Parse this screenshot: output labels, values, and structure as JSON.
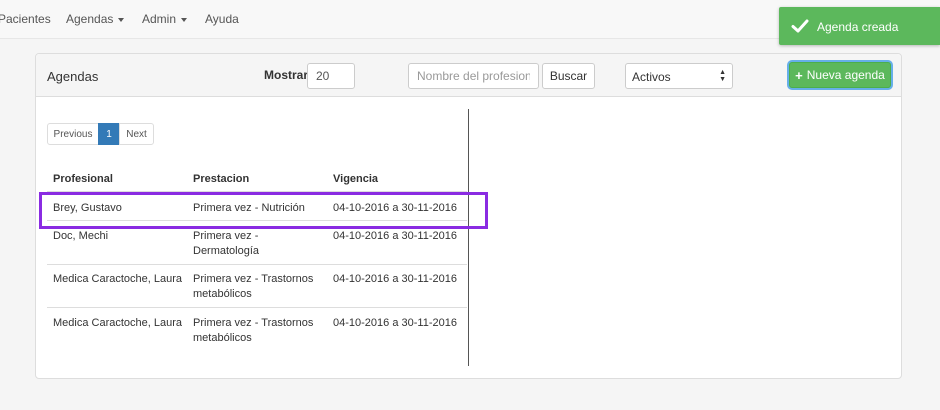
{
  "nav": {
    "items": [
      {
        "label": "Pacientes",
        "dropdown": false
      },
      {
        "label": "Agendas",
        "dropdown": true
      },
      {
        "label": "Admin",
        "dropdown": true
      },
      {
        "label": "Ayuda",
        "dropdown": false
      }
    ]
  },
  "toast": {
    "message": "Agenda creada",
    "icon": "check-icon",
    "color": "#5cb85c"
  },
  "panel": {
    "title": "Agendas",
    "mostrar_label": "Mostrar",
    "mostrar_value": "20",
    "search_placeholder": "Nombre del profesional",
    "search_button": "Buscar",
    "status_select": "Activos",
    "new_button": "Nueva agenda"
  },
  "pagination": {
    "previous": "Previous",
    "current": "1",
    "next": "Next"
  },
  "table": {
    "headers": [
      "Profesional",
      "Prestacion",
      "Vigencia"
    ],
    "rows": [
      {
        "profesional": "Brey, Gustavo",
        "prestacion": "Primera vez - Nutrición",
        "vigencia": "04-10-2016 a 30-11-2016"
      },
      {
        "profesional": "Doc, Mechi",
        "prestacion": "Primera vez - Dermatología",
        "vigencia": "04-10-2016 a 30-11-2016"
      },
      {
        "profesional": "Medica Caractoche, Laura",
        "prestacion": "Primera vez - Trastornos metabólicos",
        "vigencia": "04-10-2016 a 30-11-2016"
      },
      {
        "profesional": "Medica Caractoche, Laura",
        "prestacion": "Primera vez - Trastornos metabólicos",
        "vigencia": "04-10-2016 a 30-11-2016"
      }
    ]
  },
  "colors": {
    "accent": "#337ab7",
    "success": "#5cb85c",
    "highlight": "#8a2be2"
  }
}
